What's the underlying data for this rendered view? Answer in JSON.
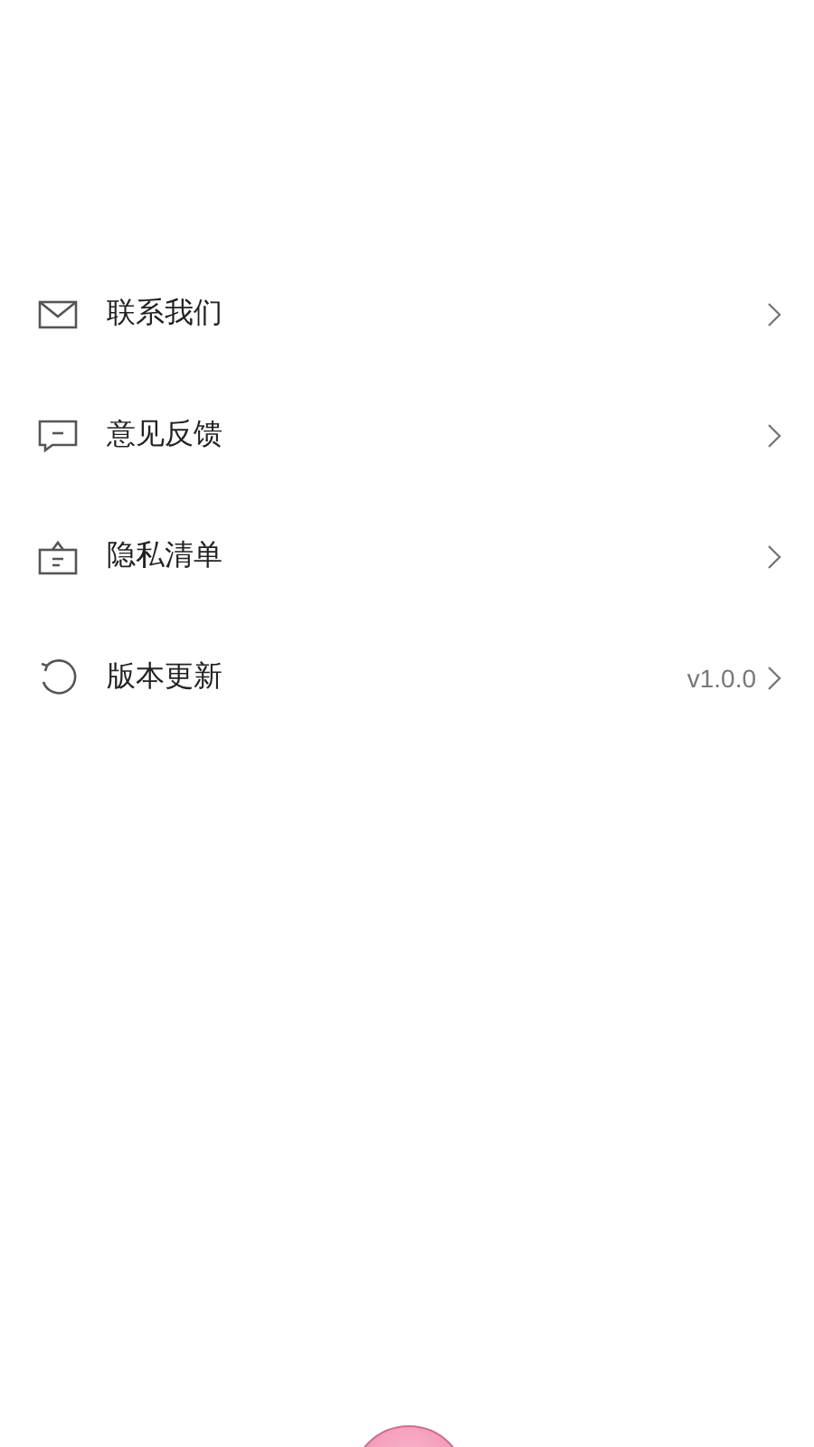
{
  "menu": [
    {
      "kind": "mail",
      "label": "联系我们"
    },
    {
      "kind": "feedback",
      "label": "意见反馈"
    },
    {
      "kind": "privacy",
      "label": "隐私清单"
    },
    {
      "kind": "update",
      "label": "版本更新",
      "value": "v1.0.0"
    }
  ]
}
